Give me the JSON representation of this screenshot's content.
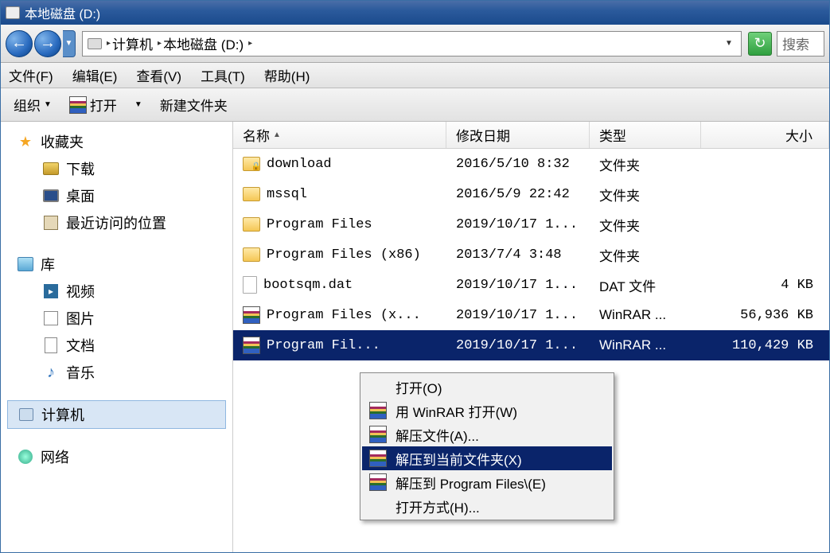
{
  "titlebar": {
    "title": "本地磁盘 (D:)"
  },
  "address": {
    "seg1": "计算机",
    "seg2": "本地磁盘 (D:)"
  },
  "search": {
    "placeholder": "搜索"
  },
  "menubar": {
    "file": "文件(F)",
    "edit": "编辑(E)",
    "view": "查看(V)",
    "tools": "工具(T)",
    "help": "帮助(H)"
  },
  "toolbar": {
    "organize": "组织",
    "open": "打开",
    "new_folder": "新建文件夹"
  },
  "sidebar": {
    "favorites_label": "收藏夹",
    "downloads": "下载",
    "desktop": "桌面",
    "recent": "最近访问的位置",
    "libraries_label": "库",
    "videos": "视频",
    "pictures": "图片",
    "documents": "文档",
    "music": "音乐",
    "computer": "计算机",
    "network": "网络"
  },
  "columns": {
    "name": "名称",
    "date": "修改日期",
    "type": "类型",
    "size": "大小"
  },
  "rows": [
    {
      "name": "download",
      "date": "2016/5/10 8:32",
      "type": "文件夹",
      "size": "",
      "icon": "folder-lock"
    },
    {
      "name": "mssql",
      "date": "2016/5/9 22:42",
      "type": "文件夹",
      "size": "",
      "icon": "folder"
    },
    {
      "name": "Program Files",
      "date": "2019/10/17 1...",
      "type": "文件夹",
      "size": "",
      "icon": "folder"
    },
    {
      "name": "Program Files (x86)",
      "date": "2013/7/4 3:48",
      "type": "文件夹",
      "size": "",
      "icon": "folder"
    },
    {
      "name": "bootsqm.dat",
      "date": "2019/10/17 1...",
      "type": "DAT 文件",
      "size": "4 KB",
      "icon": "file"
    },
    {
      "name": "Program Files (x...",
      "date": "2019/10/17 1...",
      "type": "WinRAR ...",
      "size": "56,936 KB",
      "icon": "rar"
    },
    {
      "name": "Program Fil...",
      "date": "2019/10/17 1...",
      "type": "WinRAR ...",
      "size": "110,429 KB",
      "icon": "rar",
      "selected": true
    }
  ],
  "context_menu": {
    "open": "打开(O)",
    "open_with_winrar": "用 WinRAR 打开(W)",
    "extract_files": "解压文件(A)...",
    "extract_here": "解压到当前文件夹(X)",
    "extract_to": "解压到 Program Files\\(E)",
    "open_with": "打开方式(H)..."
  }
}
